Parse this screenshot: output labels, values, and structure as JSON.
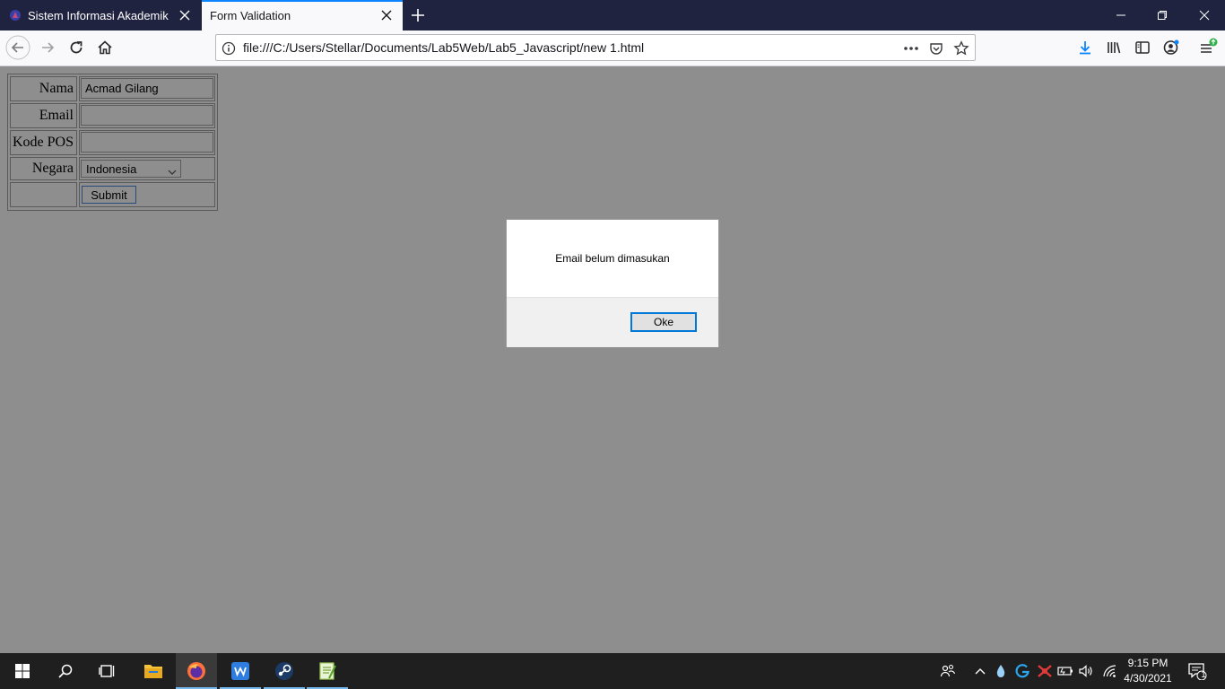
{
  "browser": {
    "tabs": [
      {
        "title": "Sistem Informasi Akademik",
        "active": false
      },
      {
        "title": "Form Validation",
        "active": true
      }
    ],
    "url": "file:///C:/Users/Stellar/Documents/Lab5Web/Lab5_Javascript/new 1.html",
    "accent": "#0a84ff"
  },
  "form": {
    "nama_label": "Nama",
    "nama_value": "Acmad Gilang",
    "email_label": "Email",
    "email_value": "",
    "kodepos_label": "Kode POS",
    "kodepos_value": "",
    "negara_label": "Negara",
    "negara_selected": "Indonesia",
    "submit_label": "Submit"
  },
  "alert": {
    "message": "Email belum dimasukan",
    "ok_label": "Oke"
  },
  "taskbar": {
    "time": "9:15 PM",
    "date": "4/30/2021",
    "notification_count": "1"
  }
}
